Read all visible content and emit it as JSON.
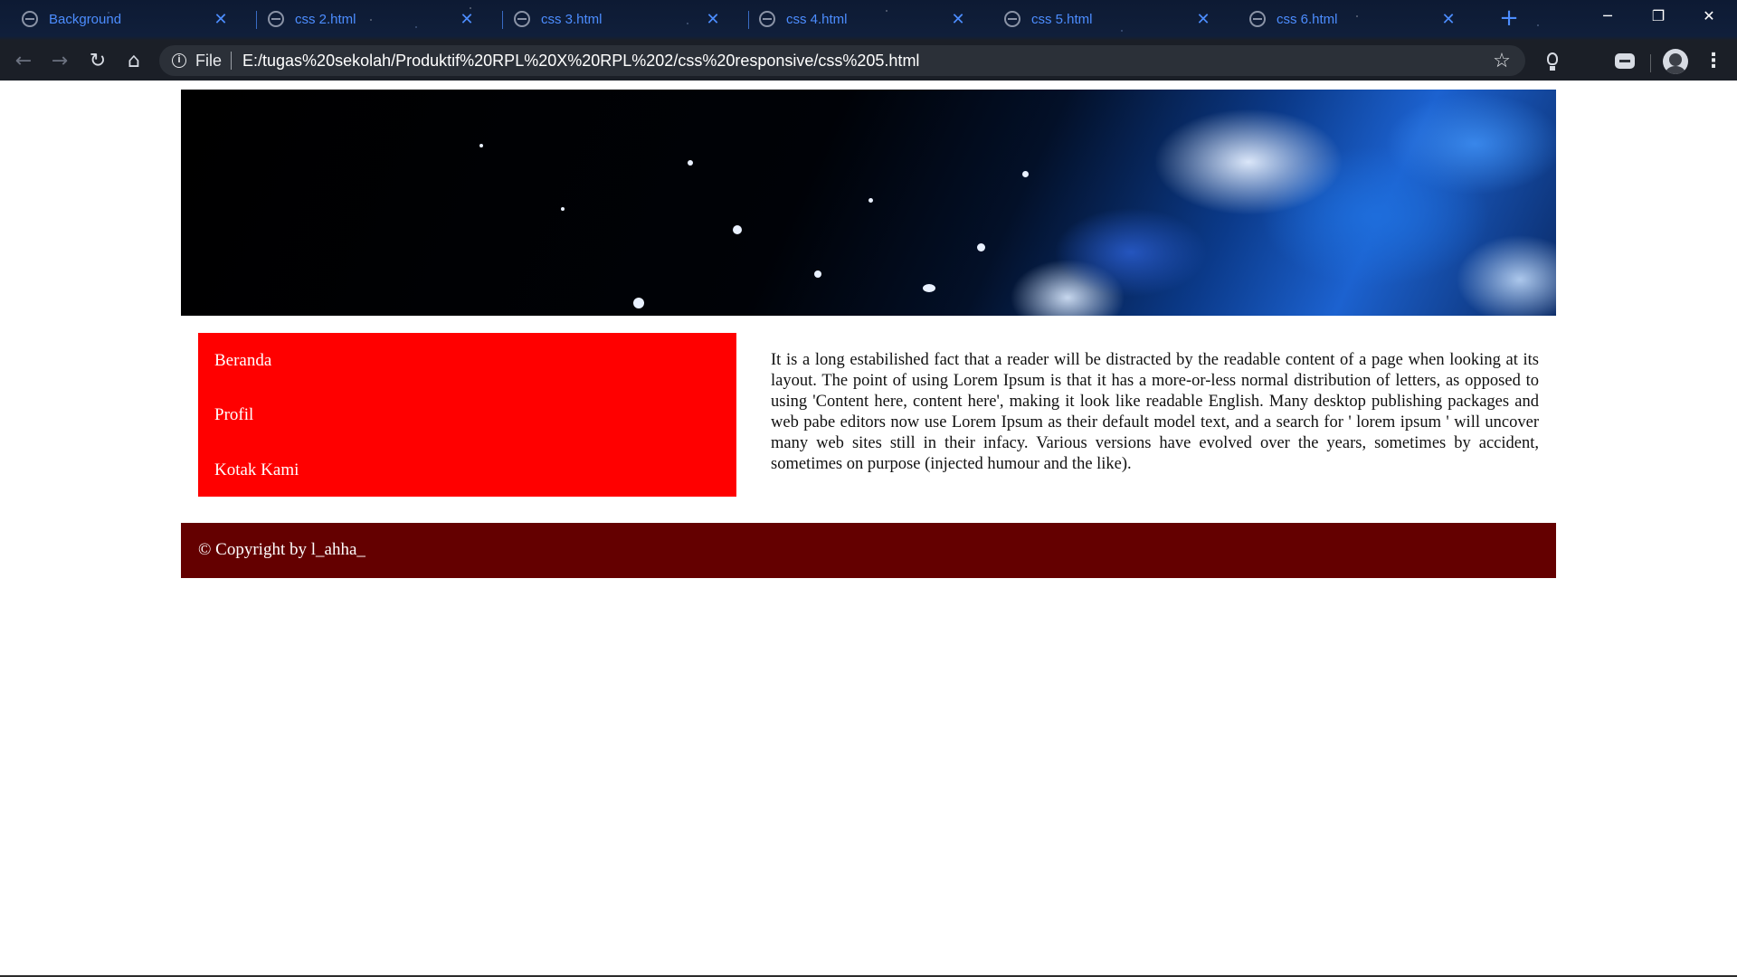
{
  "browser": {
    "tabs": [
      {
        "label": "Background"
      },
      {
        "label": "css 2.html"
      },
      {
        "label": "css 3.html"
      },
      {
        "label": "css 4.html"
      },
      {
        "label": "css 5.html"
      },
      {
        "label": "css 6.html"
      }
    ],
    "new_tab_label": "+",
    "window_controls": {
      "minimize": "─",
      "restore": "❐",
      "close": "✕"
    },
    "address": {
      "scheme_label": "File",
      "url": "E:/tugas%20sekolah/Produktif%20RPL%20X%20RPL%202/css%20responsive/css%205.html"
    }
  },
  "icons": {
    "back": "arrow-left-icon",
    "forward": "arrow-right-icon",
    "reload": "reload-icon",
    "home": "home-icon",
    "info": "info-icon",
    "star": "star-icon",
    "menu": "kebab-menu-icon"
  },
  "colors": {
    "sidebar_bg": "#ff0000",
    "footer_bg": "#640000",
    "tab_text": "#4c8dff"
  },
  "page": {
    "nav": [
      {
        "label": "Beranda"
      },
      {
        "label": "Profil"
      },
      {
        "label": "Kotak Kami"
      }
    ],
    "article": "It is a long estabilished fact that a reader will be distracted by the readable content of a page when looking at its layout. The point of using Lorem Ipsum is that it has a more-or-less normal distribution of letters, as opposed to using 'Content here, content here', making it look like readable English. Many desktop publishing packages and web pabe editors now use Lorem Ipsum as their default model text, and a search for ' lorem ipsum ' will uncover many web sites still in their infacy. Various versions have evolved over the years, sometimes by accident, sometimes on purpose (injected humour and the like).",
    "footer": "© Copyright by l_ahha_"
  }
}
